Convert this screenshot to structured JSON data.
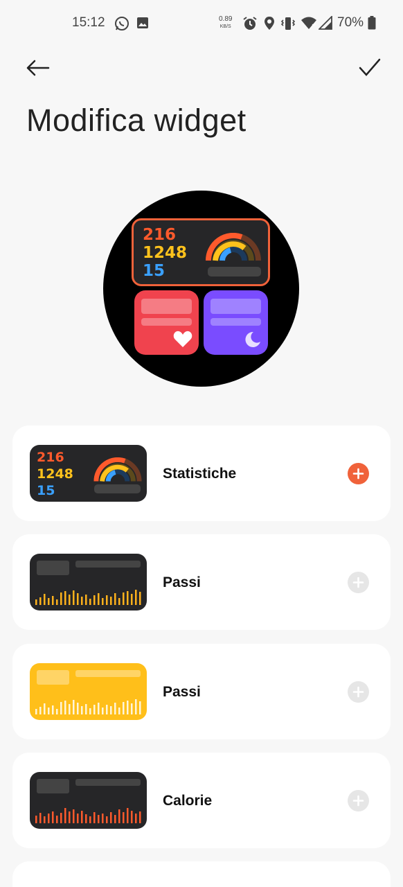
{
  "status_bar": {
    "time": "15:12",
    "speed_value": "0.89",
    "speed_unit": "KB/S",
    "battery": "70%",
    "icons": [
      "whatsapp-icon",
      "gallery-icon",
      "alarm-icon",
      "location-icon",
      "vibrate-icon",
      "wifi-icon",
      "signal-icon",
      "battery-icon"
    ]
  },
  "header": {
    "title": "Modifica widget",
    "back_icon": "arrow-left-icon",
    "confirm_icon": "checkmark-icon"
  },
  "preview": {
    "stats": [
      "216",
      "1248",
      "15"
    ],
    "stat_colors": [
      "#ff5a2c",
      "#ffc21c",
      "#3aa0ff"
    ],
    "heart_tile_color": "#f0434e",
    "sleep_tile_color": "#7a4cff"
  },
  "widgets": [
    {
      "label": "Statistiche",
      "stats": [
        "216",
        "1248",
        "15"
      ],
      "added": true,
      "style": "stats"
    },
    {
      "label": "Passi",
      "added": false,
      "style": "steps-dark"
    },
    {
      "label": "Passi",
      "added": false,
      "style": "steps-yellow"
    },
    {
      "label": "Calorie",
      "added": false,
      "style": "calories-dark"
    }
  ],
  "colors": {
    "accent": "#f0623a",
    "add_inactive": "#e6e6e6",
    "background": "#f7f7f7"
  }
}
